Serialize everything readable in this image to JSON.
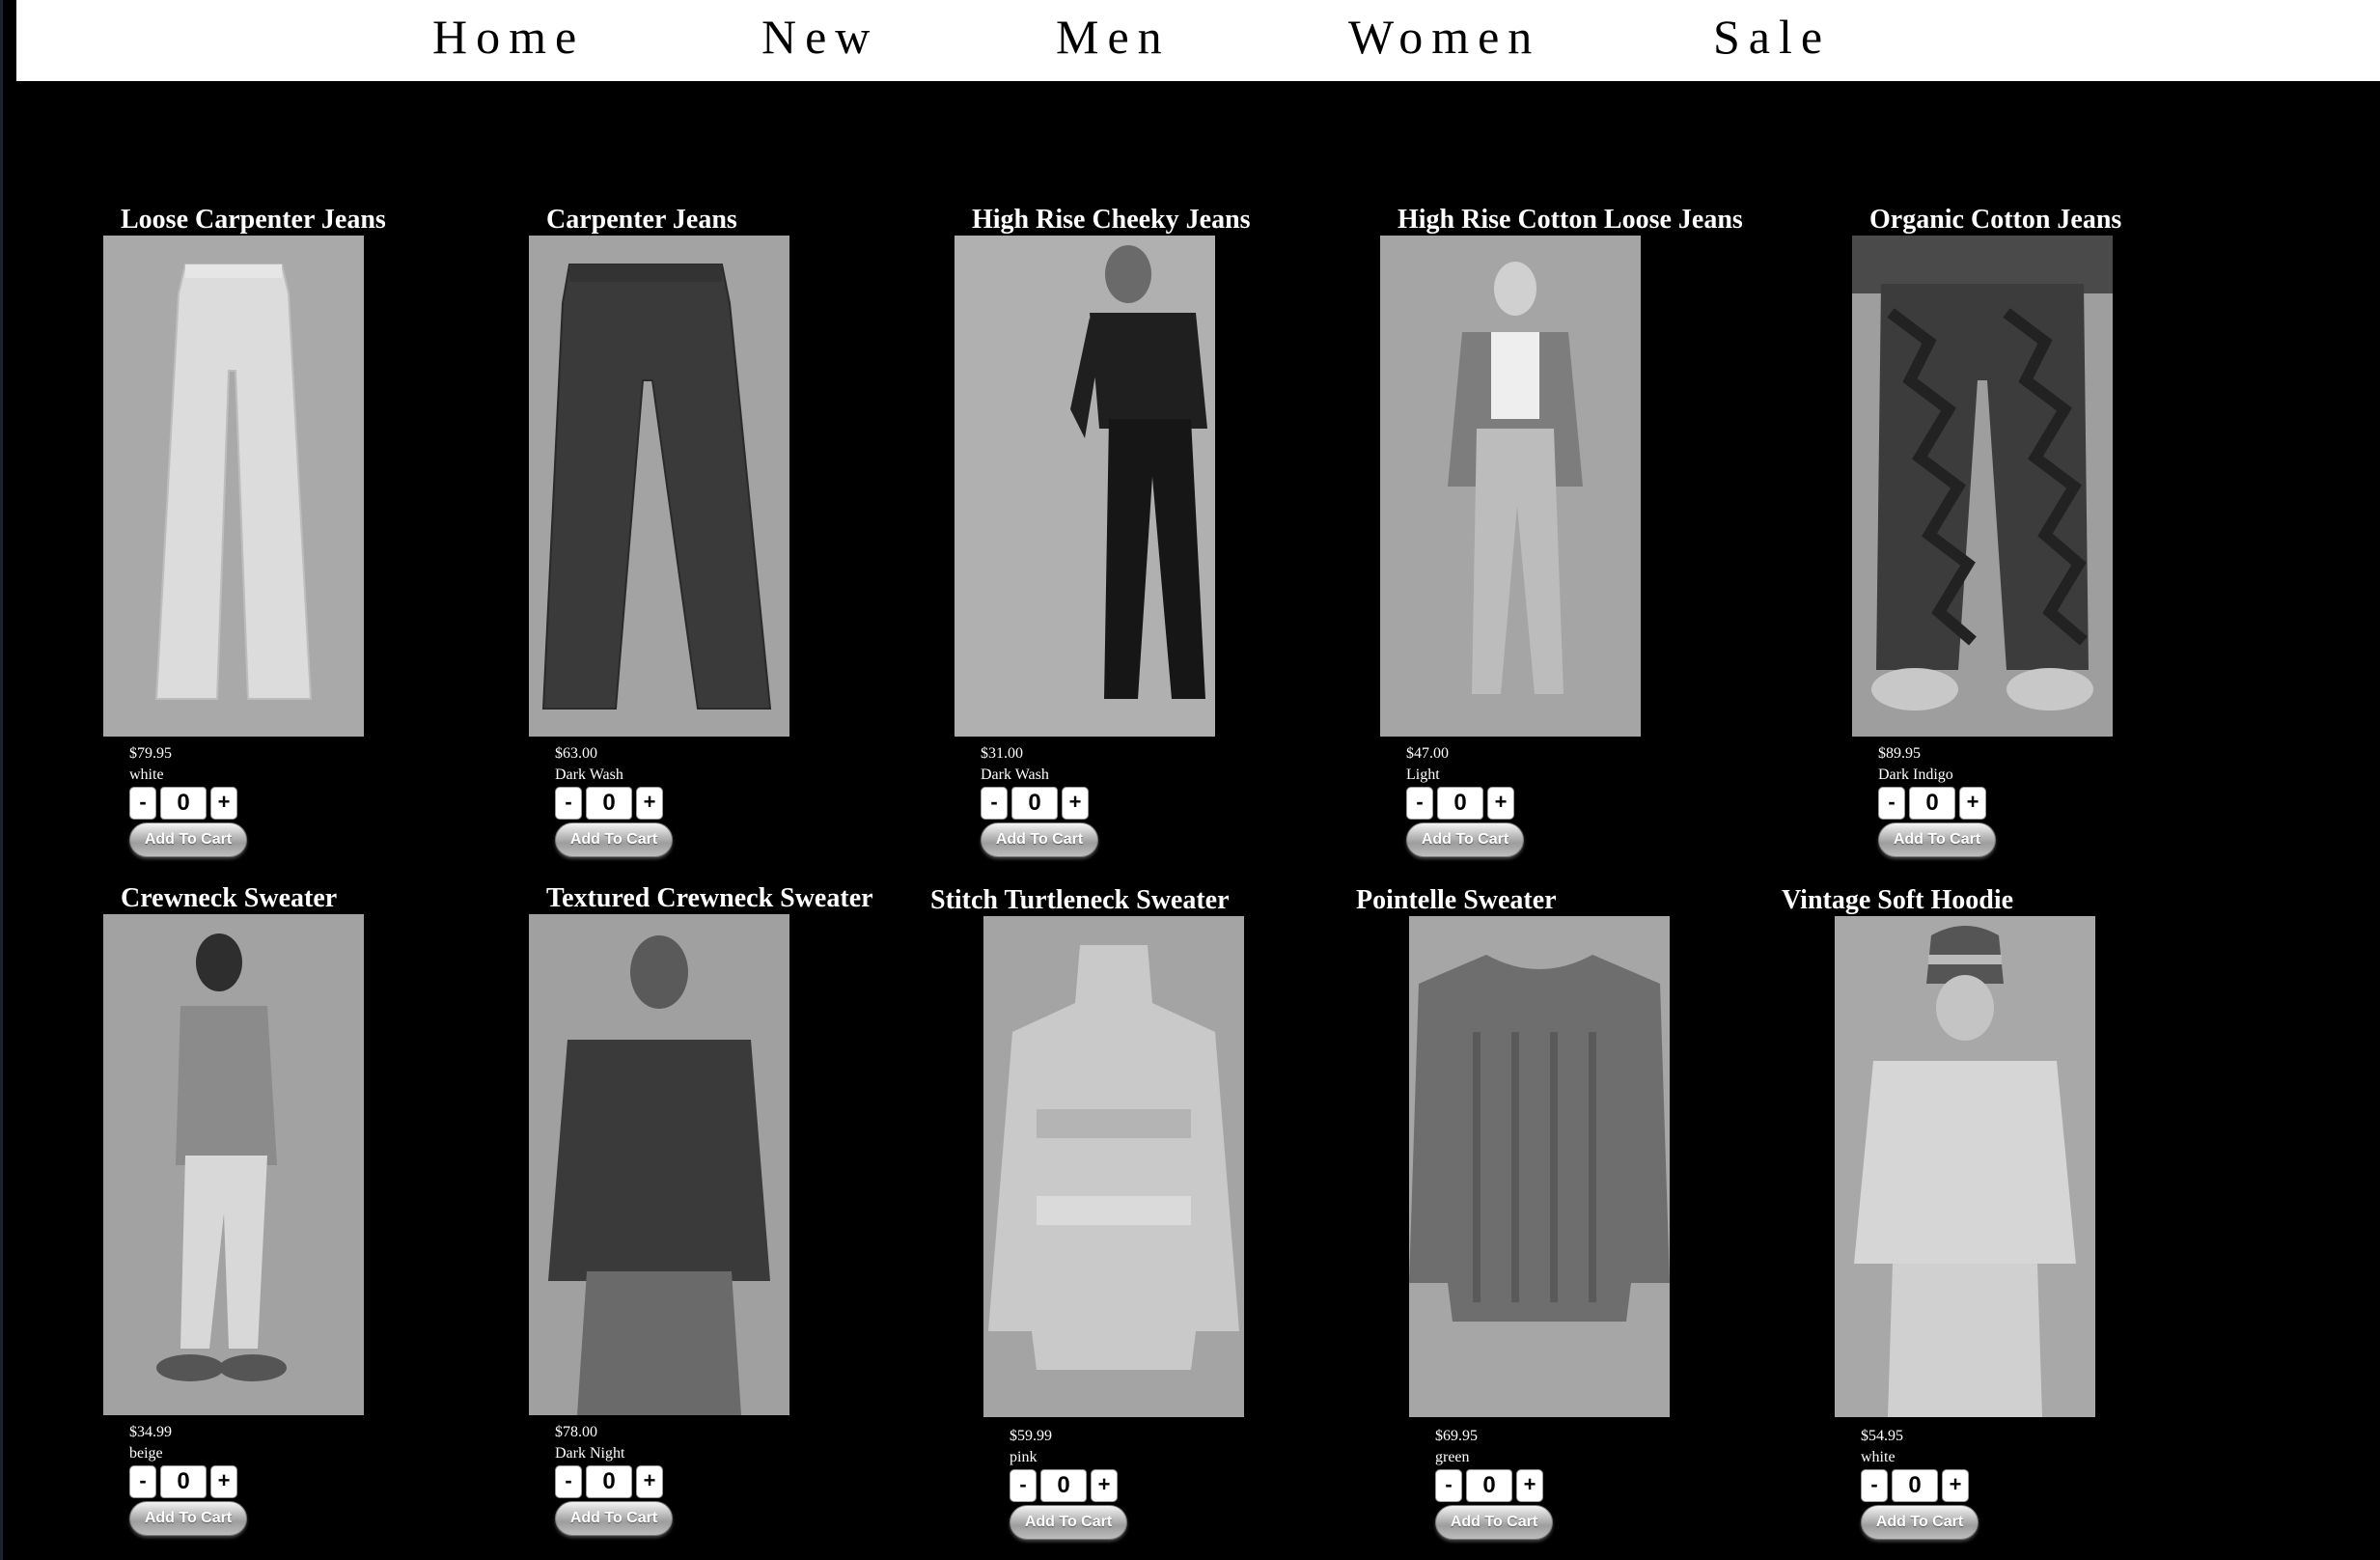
{
  "nav": {
    "home": "Home",
    "new": "New",
    "men": "Men",
    "women": "Women",
    "sale": "Sale"
  },
  "cart_button_label": "Add To Cart",
  "qty_minus": "-",
  "qty_plus": "+",
  "products": [
    {
      "name": "Loose Carpenter Jeans",
      "price": "$79.95",
      "color": "white",
      "qty": "0",
      "image": "light-jeans-flat-image"
    },
    {
      "name": "Carpenter Jeans",
      "price": "$63.00",
      "color": "Dark Wash",
      "qty": "0",
      "image": "dark-jeans-flat-image"
    },
    {
      "name": "High Rise Cheeky Jeans",
      "price": "$31.00",
      "color": "Dark Wash",
      "qty": "0",
      "image": "model-dark-jeans-image"
    },
    {
      "name": "High Rise Cotton Loose Jeans",
      "price": "$47.00",
      "color": "Light",
      "qty": "0",
      "image": "model-light-jeans-image"
    },
    {
      "name": "Organic Cotton Jeans",
      "price": "$89.95",
      "color": "Dark Indigo",
      "qty": "0",
      "image": "patterned-jeans-image"
    },
    {
      "name": "Crewneck Sweater",
      "price": "$34.99",
      "color": "beige",
      "qty": "0",
      "image": "model-crewneck-image"
    },
    {
      "name": "Textured Crewneck Sweater",
      "price": "$78.00",
      "color": "Dark Night",
      "qty": "0",
      "image": "model-textured-sweater-image"
    },
    {
      "name": "Stitch Turtleneck Sweater",
      "price": "$59.99",
      "color": "pink",
      "qty": "0",
      "image": "turtleneck-flat-image"
    },
    {
      "name": "Pointelle Sweater",
      "price": "$69.95",
      "color": "green",
      "qty": "0",
      "image": "pointelle-flat-image"
    },
    {
      "name": "Vintage Soft Hoodie",
      "price": "$54.95",
      "color": "white",
      "qty": "0",
      "image": "model-hoodie-image"
    }
  ]
}
